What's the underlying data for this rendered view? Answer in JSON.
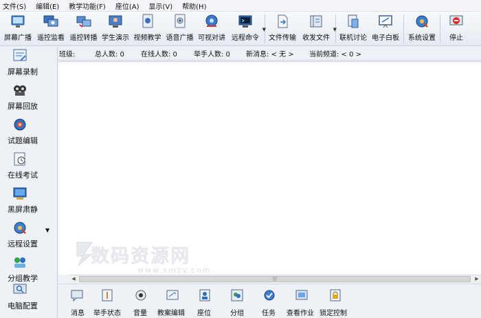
{
  "menu": [
    "文件(S)",
    "编辑(E)",
    "教学功能(F)",
    "座位(A)",
    "显示(V)",
    "帮助(H)"
  ],
  "toolbar": [
    {
      "label": "屏幕广播",
      "icon": "monitor-broadcast-icon"
    },
    {
      "label": "遥控监看",
      "icon": "remote-monitor-icon"
    },
    {
      "label": "遥控转播",
      "icon": "remote-relay-icon"
    },
    {
      "label": "学生演示",
      "icon": "student-demo-icon"
    },
    {
      "label": "视频教学",
      "icon": "video-teaching-icon"
    },
    {
      "label": "语音广播",
      "icon": "voice-broadcast-icon"
    },
    {
      "label": "可视对讲",
      "icon": "video-intercom-icon"
    },
    {
      "label": "远程命令",
      "icon": "remote-command-icon"
    },
    {
      "label": "文件传输",
      "icon": "file-transfer-icon"
    },
    {
      "label": "收发文件",
      "icon": "send-receive-files-icon"
    },
    {
      "label": "联机讨论",
      "icon": "online-discussion-icon"
    },
    {
      "label": "电子白板",
      "icon": "whiteboard-icon"
    },
    {
      "label": "系统设置",
      "icon": "system-settings-icon"
    },
    {
      "label": "停止",
      "icon": "stop-icon"
    }
  ],
  "status": {
    "class": "班级:",
    "total": "总人数: 0",
    "online": "在线人数: 0",
    "hands": "举手人数: 0",
    "message": "新消息: < 无 >",
    "channel": "当前频道: < 0 >"
  },
  "sidebar": [
    {
      "label": "屏幕录制",
      "icon": "screen-record-icon"
    },
    {
      "label": "屏幕回放",
      "icon": "screen-playback-icon"
    },
    {
      "label": "试题编辑",
      "icon": "exam-edit-icon"
    },
    {
      "label": "在线考试",
      "icon": "online-exam-icon"
    },
    {
      "label": "黑屏肃静",
      "icon": "black-screen-icon"
    },
    {
      "label": "远程设置",
      "icon": "remote-settings-icon"
    },
    {
      "label": "分组教学",
      "icon": "group-teaching-icon"
    },
    {
      "label": "电脑配置",
      "icon": "computer-config-icon"
    }
  ],
  "bottombar": [
    {
      "label": "消息",
      "icon": "message-icon"
    },
    {
      "label": "举手状态",
      "icon": "raise-hand-icon"
    },
    {
      "label": "音量",
      "icon": "volume-icon"
    },
    {
      "label": "教案编辑",
      "icon": "lesson-plan-icon"
    },
    {
      "label": "座位",
      "icon": "seat-icon"
    },
    {
      "label": "分组",
      "icon": "group-icon"
    },
    {
      "label": "任务",
      "icon": "task-icon"
    },
    {
      "label": "查看作业",
      "icon": "view-homework-icon"
    },
    {
      "label": "锁定控制",
      "icon": "lock-control-icon"
    }
  ],
  "watermark": {
    "text": "数码资源网",
    "url": "www.smzy.com"
  },
  "colors": {
    "accent": "#3a78c8",
    "toolbar_bg": "#e6ebf2",
    "content_bg": "#ffffff"
  }
}
